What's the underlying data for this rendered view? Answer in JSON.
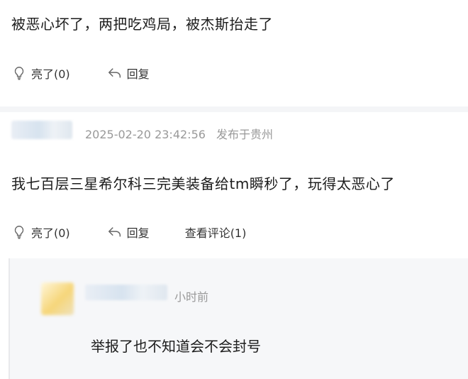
{
  "comment1": {
    "text": "被恶心坏了，两把吃鸡局，被杰斯抬走了",
    "like_label": "亮了(0)",
    "reply_label": "回复"
  },
  "comment2": {
    "timestamp": "2025-02-20 23:42:56",
    "location": "发布于贵州",
    "text": "我七百层三星希尔科三完美装备给tm瞬秒了，玩得太恶心了",
    "like_label": "亮了(0)",
    "reply_label": "回复",
    "view_comments_label": "查看评论(1)"
  },
  "reply": {
    "time": "小时前",
    "text": "举报了也不知道会不会封号"
  },
  "icons": {
    "like": "lightbulb-icon",
    "reply": "reply-arrow-icon"
  }
}
